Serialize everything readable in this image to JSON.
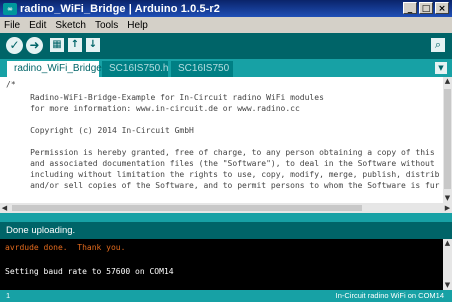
{
  "window": {
    "logo_text": "∞",
    "title": "radino_WiFi_Bridge | Arduino 1.0.5-r2",
    "controls": [
      "_",
      "□",
      "×"
    ]
  },
  "menu": [
    "File",
    "Edit",
    "Sketch",
    "Tools",
    "Help"
  ],
  "toolbar": {
    "buttons": [
      {
        "icon": "check-icon",
        "glyph": "✓"
      },
      {
        "icon": "arrow-right-icon",
        "glyph": "➜"
      },
      {
        "icon": "new-icon",
        "glyph": "▦"
      },
      {
        "icon": "open-icon",
        "glyph": "↑"
      },
      {
        "icon": "save-icon",
        "glyph": "↓"
      }
    ],
    "search_glyph": "⌕"
  },
  "tabs": [
    {
      "label": "radino_WiFi_Bridge",
      "active": true
    },
    {
      "label": "SC16IS750.h",
      "active": false
    },
    {
      "label": "SC16IS750",
      "active": false
    }
  ],
  "tab_menu_glyph": "▼",
  "editor": {
    "lines": [
      "/*",
      "     Radino-WiFi-Bridge-Example for In-Circuit radino WiFi modules",
      "     for more information: www.in-circuit.de or www.radino.cc",
      "",
      "     Copyright (c) 2014 In-Circuit GmbH",
      "",
      "     Permission is hereby granted, free of charge, to any person obtaining a copy of this",
      "     and associated documentation files (the \"Software\"), to deal in the Software without",
      "     including without limitation the rights to use, copy, modify, merge, publish, distrib",
      "     and/or sell copies of the Software, and to permit persons to whom the Software is fur"
    ]
  },
  "status": "Done uploading.",
  "console": {
    "lines": [
      {
        "text": "avrdude done.  Thank you.",
        "color": "#e36a1d"
      },
      {
        "text": "",
        "color": "#ffffff"
      },
      {
        "text": "Setting baud rate to 57600 on COM14",
        "color": "#ffffff"
      }
    ]
  },
  "footer": {
    "line_number": "1",
    "board": "In-Circuit radino WiFi on COM14"
  },
  "colors": {
    "teal_dark": "#006468",
    "teal": "#17a1a5",
    "console_orange": "#e36a1d"
  }
}
